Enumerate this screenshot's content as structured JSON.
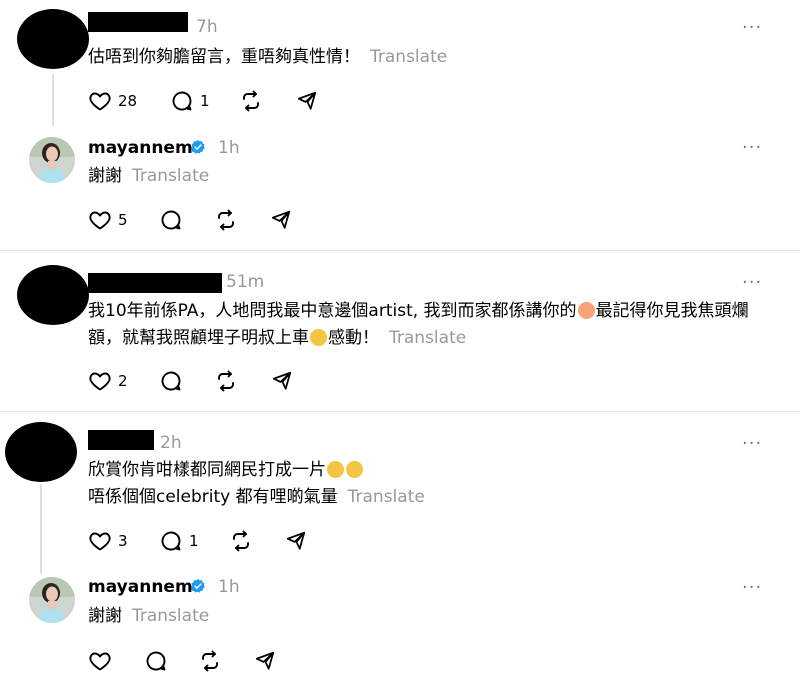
{
  "translate_label": "Translate",
  "more_label": "···",
  "posts": [
    {
      "time": "7h",
      "lines": [
        "估唔到你夠膽留言，重唔夠真性情！"
      ],
      "likes": "28",
      "replies": "1",
      "reply": {
        "username": "mayannem",
        "time": "1h",
        "text": "謝謝",
        "likes": "5"
      }
    },
    {
      "time": "51m",
      "line1": "我10年前係PA，人地問我最中意邊個artist, 我到而家都係講你的",
      "line1b": "最記得你見我焦頭爛",
      "line2a": "額，就幫我照顧埋子明叔上車",
      "line2b": "感動！",
      "likes": "2"
    },
    {
      "time": "2h",
      "line1": "欣賞你肯咁樣都同網民打成一片",
      "line2": "唔係個個celebrity 都有哩啲氣量",
      "likes": "3",
      "replies": "1",
      "reply": {
        "username": "mayannem",
        "time": "1h",
        "text": "謝謝"
      }
    }
  ],
  "colors": {
    "verified": "#1d9bf0",
    "muted": "#999999",
    "divider": "#e6e6e6"
  }
}
